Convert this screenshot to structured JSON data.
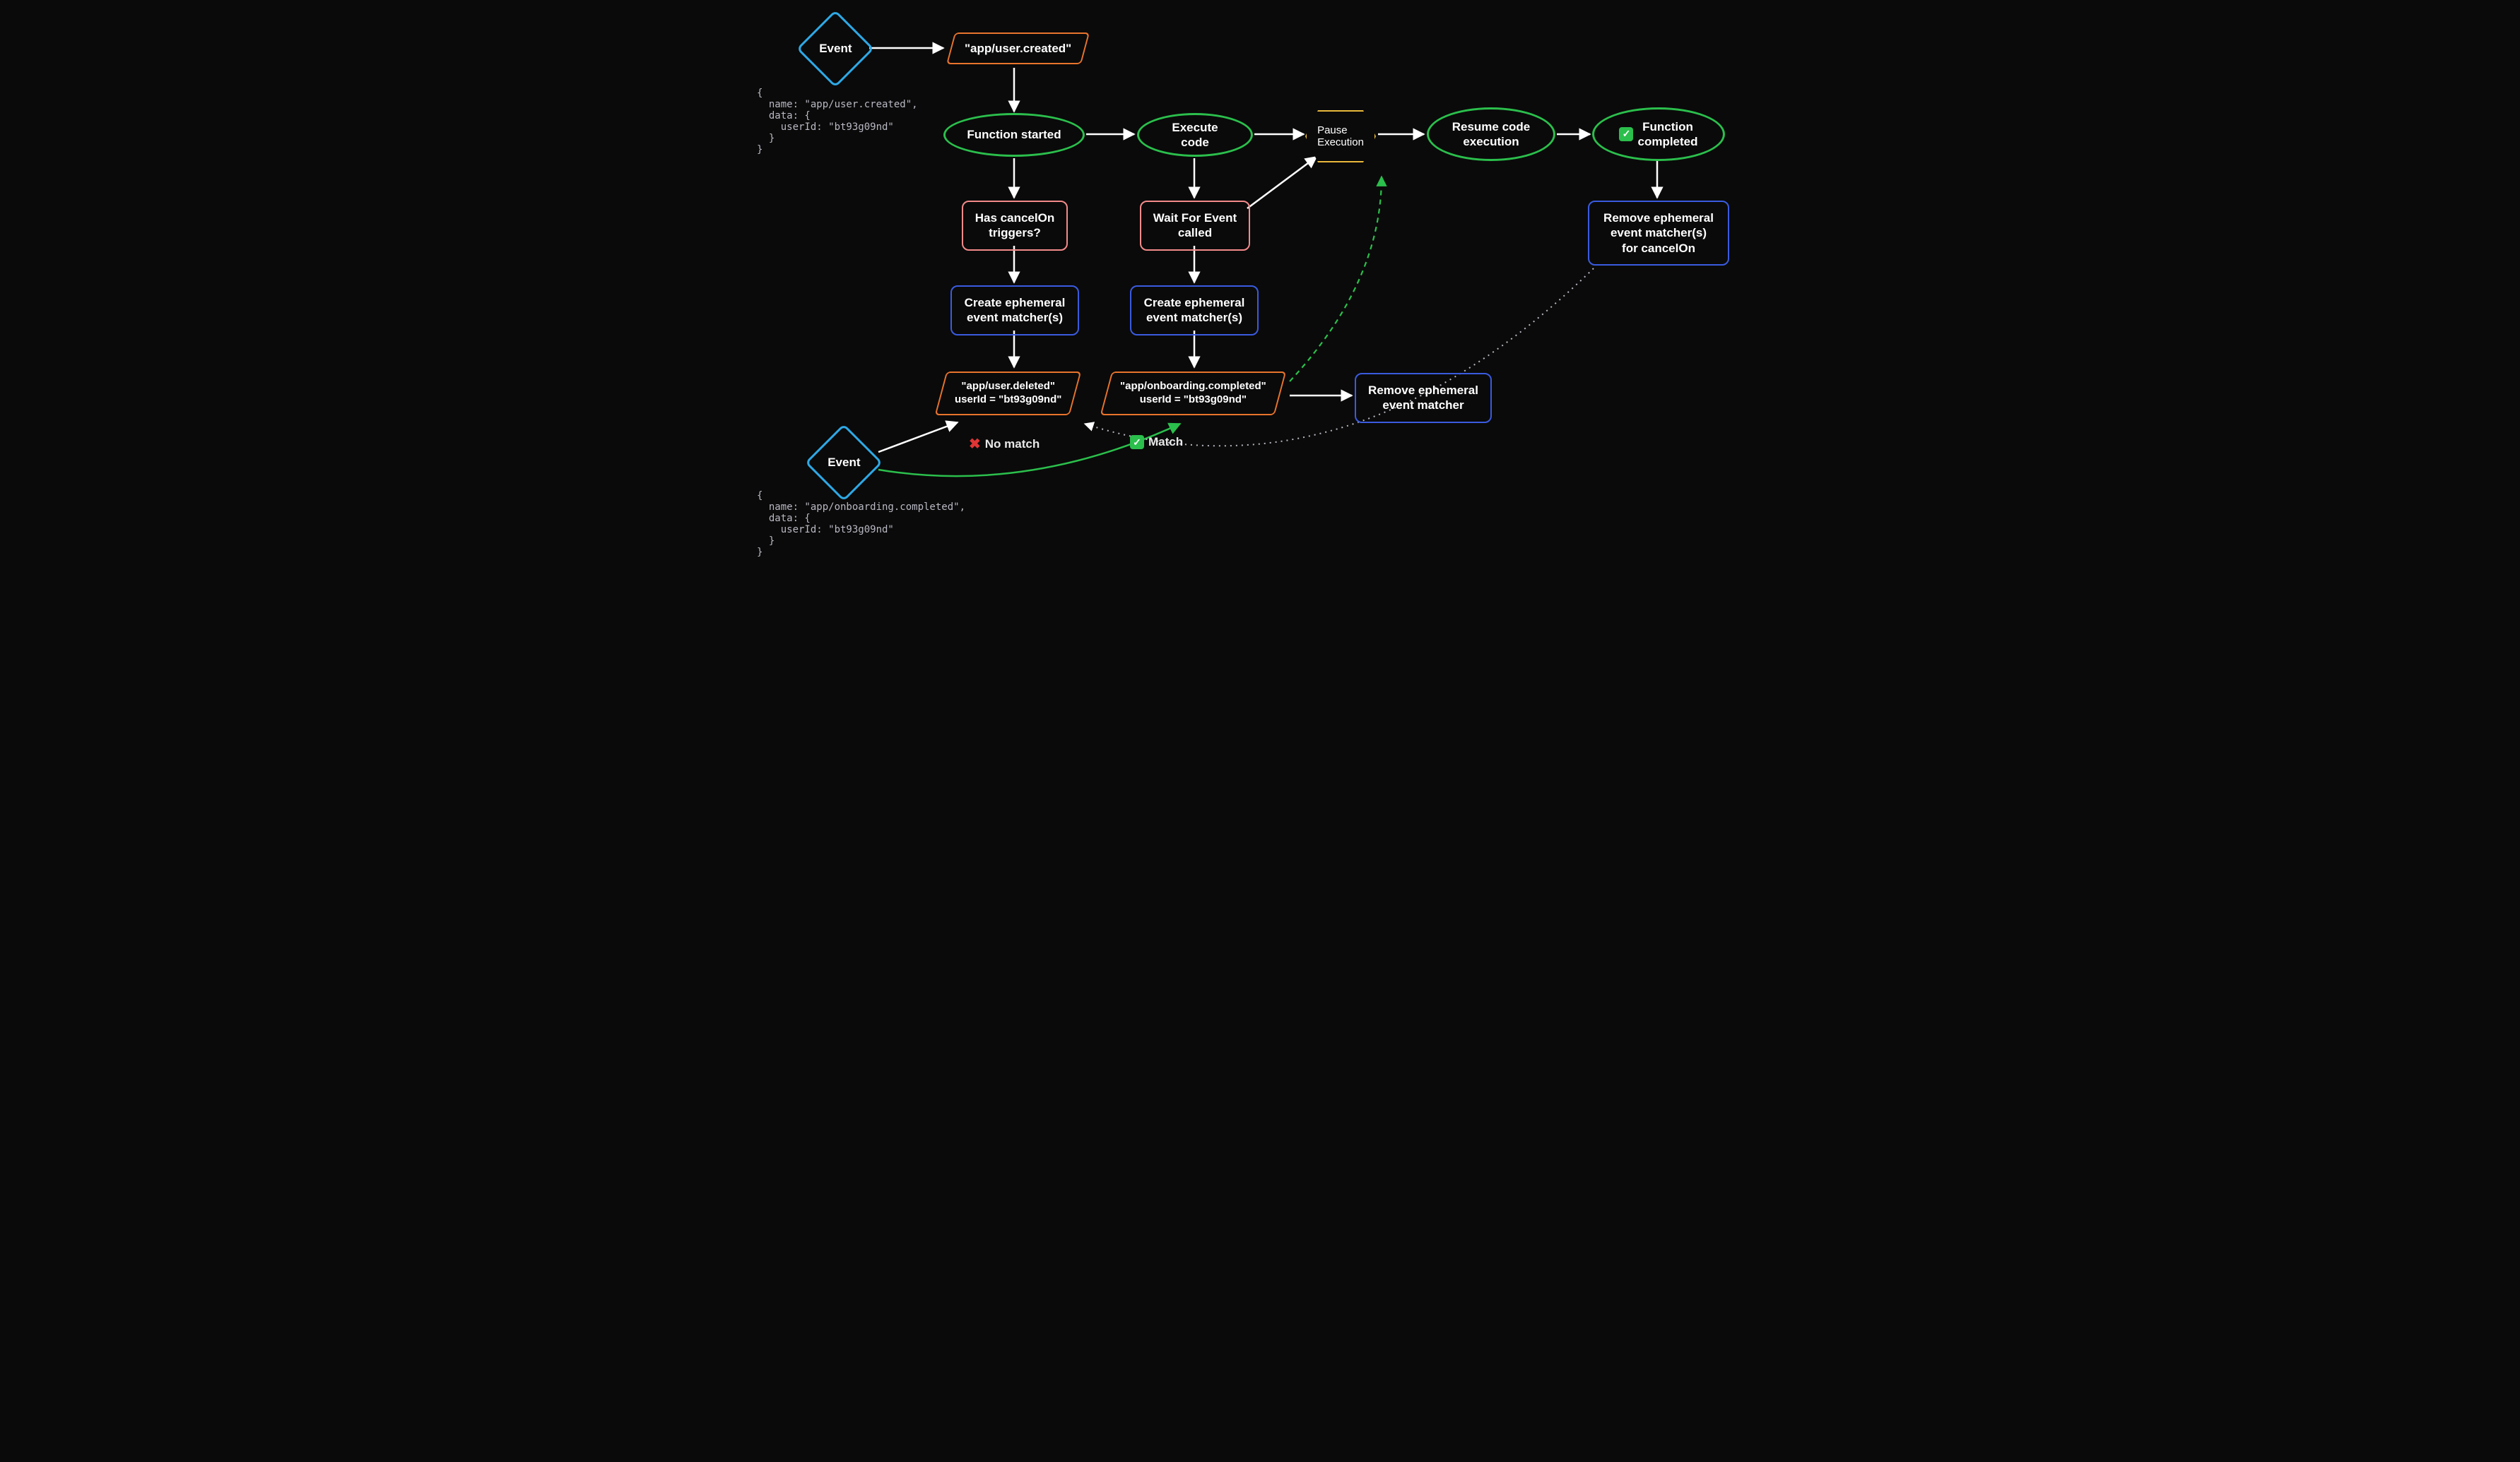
{
  "events": {
    "top": {
      "label": "Event"
    },
    "bottom": {
      "label": "Event"
    }
  },
  "code": {
    "top": "{\n  name: \"app/user.created\",\n  data: {\n    userId: \"bt93g09nd\"\n  }\n}",
    "bottom": "{\n  name: \"app/onboarding.completed\",\n  data: {\n    userId: \"bt93g09nd\"\n  }\n}"
  },
  "nodes": {
    "trigger_event": "\"app/user.created\"",
    "function_started": "Function started",
    "execute_code": "Execute code",
    "pause_execution": "Pause\nExecution",
    "resume_execution": "Resume code\nexecution",
    "function_completed": "Function\ncompleted",
    "has_cancel": "Has cancelOn\ntriggers?",
    "wait_for_event": "Wait For Event\ncalled",
    "create_matcher_left": "Create ephemeral\nevent matcher(s)",
    "create_matcher_right": "Create ephemeral\nevent matcher(s)",
    "matcher_deleted": "\"app/user.deleted\"\nuserId = \"bt93g09nd\"",
    "matcher_onboarding": "\"app/onboarding.completed\"\nuserId = \"bt93g09nd\"",
    "remove_matcher": "Remove ephemeral\nevent matcher",
    "remove_cancel_matchers": "Remove ephemeral\nevent matcher(s)\nfor cancelOn"
  },
  "labels": {
    "no_match": "No match",
    "match": "Match"
  }
}
